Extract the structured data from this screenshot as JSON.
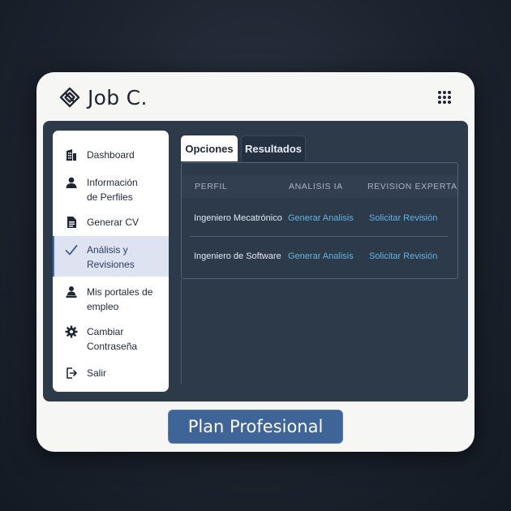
{
  "brand": {
    "name": "Job C.",
    "logo_icon": "diamond-knot-icon"
  },
  "header": {
    "apps_icon": "grid-dots-icon"
  },
  "sidebar": {
    "items": [
      {
        "label": "Dashboard",
        "icon": "building-icon",
        "active": false
      },
      {
        "label": "Información\nde Perfiles",
        "icon": "user-icon",
        "active": false
      },
      {
        "label": "Generar CV",
        "icon": "document-icon",
        "active": false
      },
      {
        "label": "Análisis y\nRevisiones",
        "icon": "checkmark-icon",
        "active": true
      },
      {
        "label": "Mis portales de\nempleo",
        "icon": "person-desk-icon",
        "active": false
      },
      {
        "label": "Cambiar\nContraseña",
        "icon": "gear-icon",
        "active": false
      },
      {
        "label": "Salir",
        "icon": "logout-icon",
        "active": false
      }
    ]
  },
  "tabs": [
    {
      "label": "Opciones",
      "active": true
    },
    {
      "label": "Resultados",
      "active": false
    }
  ],
  "table": {
    "headers": [
      "PERFIL",
      "ANALISIS IA",
      "REVISION EXPERTA"
    ],
    "rows": [
      {
        "profile": "Ingeniero Mecatrónico",
        "ai_action": "Generar Analisis",
        "expert_action": "Solicitar Revisión"
      },
      {
        "profile": "Ingeniero de Software",
        "ai_action": "Generar Analisis",
        "expert_action": "Solicitar Revisión"
      }
    ]
  },
  "plan_button": {
    "label": "Plan Profesional"
  },
  "colors": {
    "accent": "#3f6498",
    "link": "#63b4e3",
    "panel": "#2d3a4a",
    "sidebar_active": "#dde3f1"
  }
}
